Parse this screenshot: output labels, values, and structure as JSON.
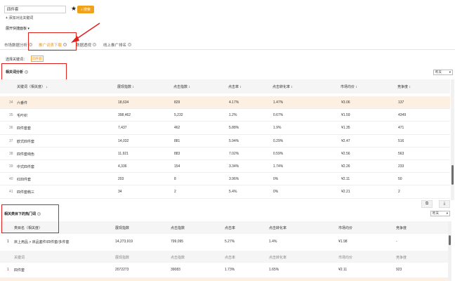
{
  "search": {
    "value": "四件套",
    "button_label": "搜索"
  },
  "add_compare_label": "添加对比关键词",
  "expand_label": "展开快捷面板",
  "tabs": [
    {
      "label": "市场数据分析"
    },
    {
      "label": "推广词表下载"
    },
    {
      "label": "数据透视"
    },
    {
      "label": "线上推广排名"
    }
  ],
  "filter": {
    "label": "选择关键词：",
    "chip": "四件套"
  },
  "related": {
    "title": "相关词分析",
    "select": "昨天",
    "columns": [
      "关键词（相关度）",
      "展现指数",
      "点击指数",
      "点击率",
      "点击转化率",
      "市场均价",
      "竞争度"
    ],
    "rows": [
      [
        "34",
        "六番件",
        "18,634",
        "829",
        "4.17%",
        "1.47%",
        "¥3.06",
        "137"
      ],
      [
        "35",
        "毛叶织",
        "398,462",
        "5,232",
        "1.2%",
        "0.67%",
        "¥1.59",
        "4349"
      ],
      [
        "36",
        "四件套套",
        "7,437",
        "462",
        "5.88%",
        "1.9%",
        "¥1.35",
        "471"
      ],
      [
        "37",
        "欧式四件套",
        "14,032",
        "881",
        "5.94%",
        "0.29%",
        "¥2.47",
        "516"
      ],
      [
        "38",
        "四件套纯色",
        "11,921",
        "883",
        "7.02%",
        "0.59%",
        "¥2.56",
        "563"
      ],
      [
        "39",
        "中式四件套",
        "4,336",
        "154",
        "3.34%",
        "1.74%",
        "¥2.26",
        "233"
      ],
      [
        "40",
        "红四件套",
        "203",
        "8",
        "3.96%",
        "0%",
        "¥2.11",
        "50"
      ],
      [
        "41",
        "四件套韩三",
        "34",
        "2",
        "5.4%",
        "0%",
        "¥2.21",
        "2"
      ]
    ]
  },
  "hot": {
    "title": "相关类目下的热门词",
    "select": "昨天",
    "columns": [
      "类目名（相关度）",
      "展现指数",
      "点击指数",
      "点击率",
      "点击转化率",
      "市场均价",
      "竞争度"
    ],
    "category_row": [
      "1",
      "床上用品 > 床品套件/四件套/多件套",
      "14,273,919",
      "799,095",
      "5.27%",
      "1.4%",
      "¥1.98",
      "-"
    ],
    "sub_columns": [
      "关键词",
      "展现指数",
      "点击指数",
      "点击率",
      "点击转化率",
      "市场均价",
      "竞争度"
    ],
    "kw_row": [
      "1",
      "四件套",
      "2072273",
      "39083",
      "1.73%",
      "1.65%",
      "¥2.11",
      "923"
    ]
  },
  "colors": {
    "accent": "#f39800",
    "annotation": "#e0211b"
  },
  "icons": [
    "star-icon",
    "search-icon",
    "plus-icon",
    "caret-down-icon",
    "help-icon",
    "sort-icon",
    "copy-icon",
    "download-icon"
  ]
}
